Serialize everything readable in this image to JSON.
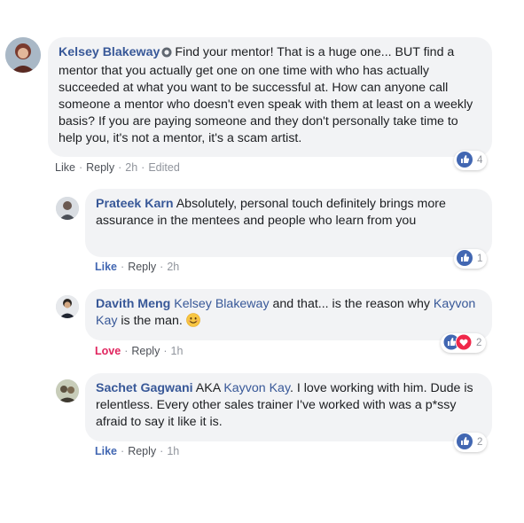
{
  "comments": [
    {
      "author": "Kelsey Blakeway",
      "text": "Find your mentor! That is a huge one... BUT find a mentor that you actually get one on one time with who has actually succeeded at what you want to be successful at. How can anyone call someone a mentor who doesn't even speak with them at least on a weekly basis? If you are paying someone and they don't personally take time to help you, it's not a mentor, it's a scam artist.",
      "actions": {
        "like": "Like",
        "reply": "Reply",
        "time": "2h",
        "edited": "Edited"
      },
      "reaction_count": "4"
    },
    {
      "author": "Prateek Karn",
      "text": "Absolutely, personal touch definitely brings more assurance in the mentees and people who learn from you",
      "actions": {
        "like": "Like",
        "reply": "Reply",
        "time": "2h"
      },
      "reaction_count": "1"
    },
    {
      "author": "Davith Meng",
      "mention": "Kelsey Blakeway",
      "text_mid": "and that... is the reason why",
      "mention2": "Kayvon Kay",
      "text_end": "is the man.",
      "emoji": "smiling-face",
      "actions": {
        "like": "Love",
        "reply": "Reply",
        "time": "1h"
      },
      "reaction_count": "2"
    },
    {
      "author": "Sachet Gagwani",
      "text_start": "AKA",
      "mention": "Kayvon Kay",
      "text_end": ". I love working with him. Dude is relentless. Every other sales trainer I've worked with was a p*ssy afraid to say it like it is.",
      "actions": {
        "like": "Like",
        "reply": "Reply",
        "time": "1h"
      },
      "reaction_count": "2"
    }
  ],
  "icons": {
    "like_reaction": "like-icon",
    "love_reaction": "heart-icon",
    "badge": "top-fan-badge-icon"
  },
  "colors": {
    "link": "#385898",
    "bubble": "#f2f3f5",
    "like_blue": "#4267b2",
    "love_red": "#e0245e",
    "meta_gray": "#90949c"
  }
}
